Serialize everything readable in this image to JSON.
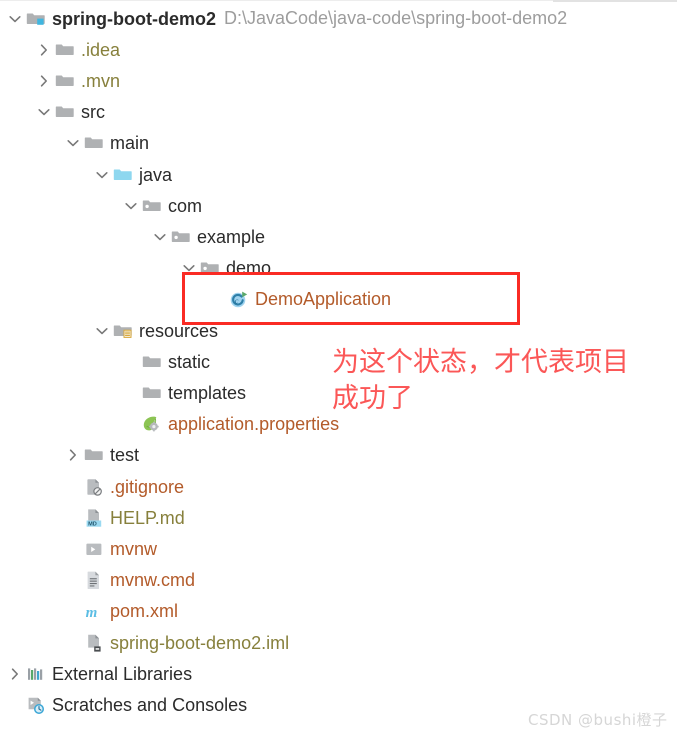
{
  "window": {
    "watermark": "CSDN @bushi橙子"
  },
  "annotation": {
    "text": "为这个状态，才代表项目\n成功了",
    "color": "#fb5757",
    "box_color": "#fa2b24"
  },
  "tree": {
    "items": [
      {
        "name": "spring-boot-demo2",
        "detail": "D:\\JavaCode\\java-code\\spring-boot-demo2",
        "icon": "project-folder-icon",
        "chevron": "chevron-down-icon",
        "depth": 0,
        "color": "dark",
        "bold": true
      },
      {
        "name": ".idea",
        "detail": "",
        "icon": "folder-icon",
        "chevron": "chevron-right-icon",
        "depth": 1,
        "color": "olive",
        "bold": false
      },
      {
        "name": ".mvn",
        "detail": "",
        "icon": "folder-icon",
        "chevron": "chevron-right-icon",
        "depth": 1,
        "color": "olive",
        "bold": false
      },
      {
        "name": "src",
        "detail": "",
        "icon": "folder-icon",
        "chevron": "chevron-down-icon",
        "depth": 1,
        "color": "dark",
        "bold": false
      },
      {
        "name": "main",
        "detail": "",
        "icon": "folder-icon",
        "chevron": "chevron-down-icon",
        "depth": 2,
        "color": "dark",
        "bold": false
      },
      {
        "name": "java",
        "detail": "",
        "icon": "source-root-folder-icon",
        "chevron": "chevron-down-icon",
        "depth": 3,
        "color": "dark",
        "bold": false
      },
      {
        "name": "com",
        "detail": "",
        "icon": "package-icon",
        "chevron": "chevron-down-icon",
        "depth": 4,
        "color": "dark",
        "bold": false
      },
      {
        "name": "example",
        "detail": "",
        "icon": "package-icon",
        "chevron": "chevron-down-icon",
        "depth": 5,
        "color": "dark",
        "bold": false
      },
      {
        "name": "demo",
        "detail": "",
        "icon": "package-icon",
        "chevron": "chevron-down-icon",
        "depth": 6,
        "color": "dark",
        "bold": false
      },
      {
        "name": "DemoApplication",
        "detail": "",
        "icon": "java-class-runnable-icon",
        "chevron": "none",
        "depth": 7,
        "color": "brown",
        "bold": false
      },
      {
        "name": "resources",
        "detail": "",
        "icon": "resource-root-folder-icon",
        "chevron": "chevron-down-icon",
        "depth": 3,
        "color": "dark",
        "bold": false
      },
      {
        "name": "static",
        "detail": "",
        "icon": "folder-icon",
        "chevron": "none",
        "depth": 4,
        "color": "dark",
        "bold": false
      },
      {
        "name": "templates",
        "detail": "",
        "icon": "folder-icon",
        "chevron": "none",
        "depth": 4,
        "color": "dark",
        "bold": false
      },
      {
        "name": "application.properties",
        "detail": "",
        "icon": "spring-properties-icon",
        "chevron": "none",
        "depth": 4,
        "color": "brown",
        "bold": false
      },
      {
        "name": "test",
        "detail": "",
        "icon": "folder-icon",
        "chevron": "chevron-right-icon",
        "depth": 2,
        "color": "dark",
        "bold": false
      },
      {
        "name": ".gitignore",
        "detail": "",
        "icon": "gitignore-file-icon",
        "chevron": "none",
        "depth": 2,
        "color": "brown",
        "bold": false
      },
      {
        "name": "HELP.md",
        "detail": "",
        "icon": "markdown-file-icon",
        "chevron": "none",
        "depth": 2,
        "color": "olive",
        "bold": false
      },
      {
        "name": "mvnw",
        "detail": "",
        "icon": "shell-script-icon",
        "chevron": "none",
        "depth": 2,
        "color": "brown",
        "bold": false
      },
      {
        "name": "mvnw.cmd",
        "detail": "",
        "icon": "text-file-icon",
        "chevron": "none",
        "depth": 2,
        "color": "brown",
        "bold": false
      },
      {
        "name": "pom.xml",
        "detail": "",
        "icon": "maven-pom-icon",
        "chevron": "none",
        "depth": 2,
        "color": "brown",
        "bold": false
      },
      {
        "name": "spring-boot-demo2.iml",
        "detail": "",
        "icon": "iml-module-file-icon",
        "chevron": "none",
        "depth": 2,
        "color": "olive",
        "bold": false
      },
      {
        "name": "External Libraries",
        "detail": "",
        "icon": "libraries-icon",
        "chevron": "chevron-right-icon",
        "depth": 0,
        "color": "dark",
        "bold": false
      },
      {
        "name": "Scratches and Consoles",
        "detail": "",
        "icon": "scratches-icon",
        "chevron": "none",
        "depth": 0,
        "color": "dark",
        "bold": false
      }
    ]
  }
}
